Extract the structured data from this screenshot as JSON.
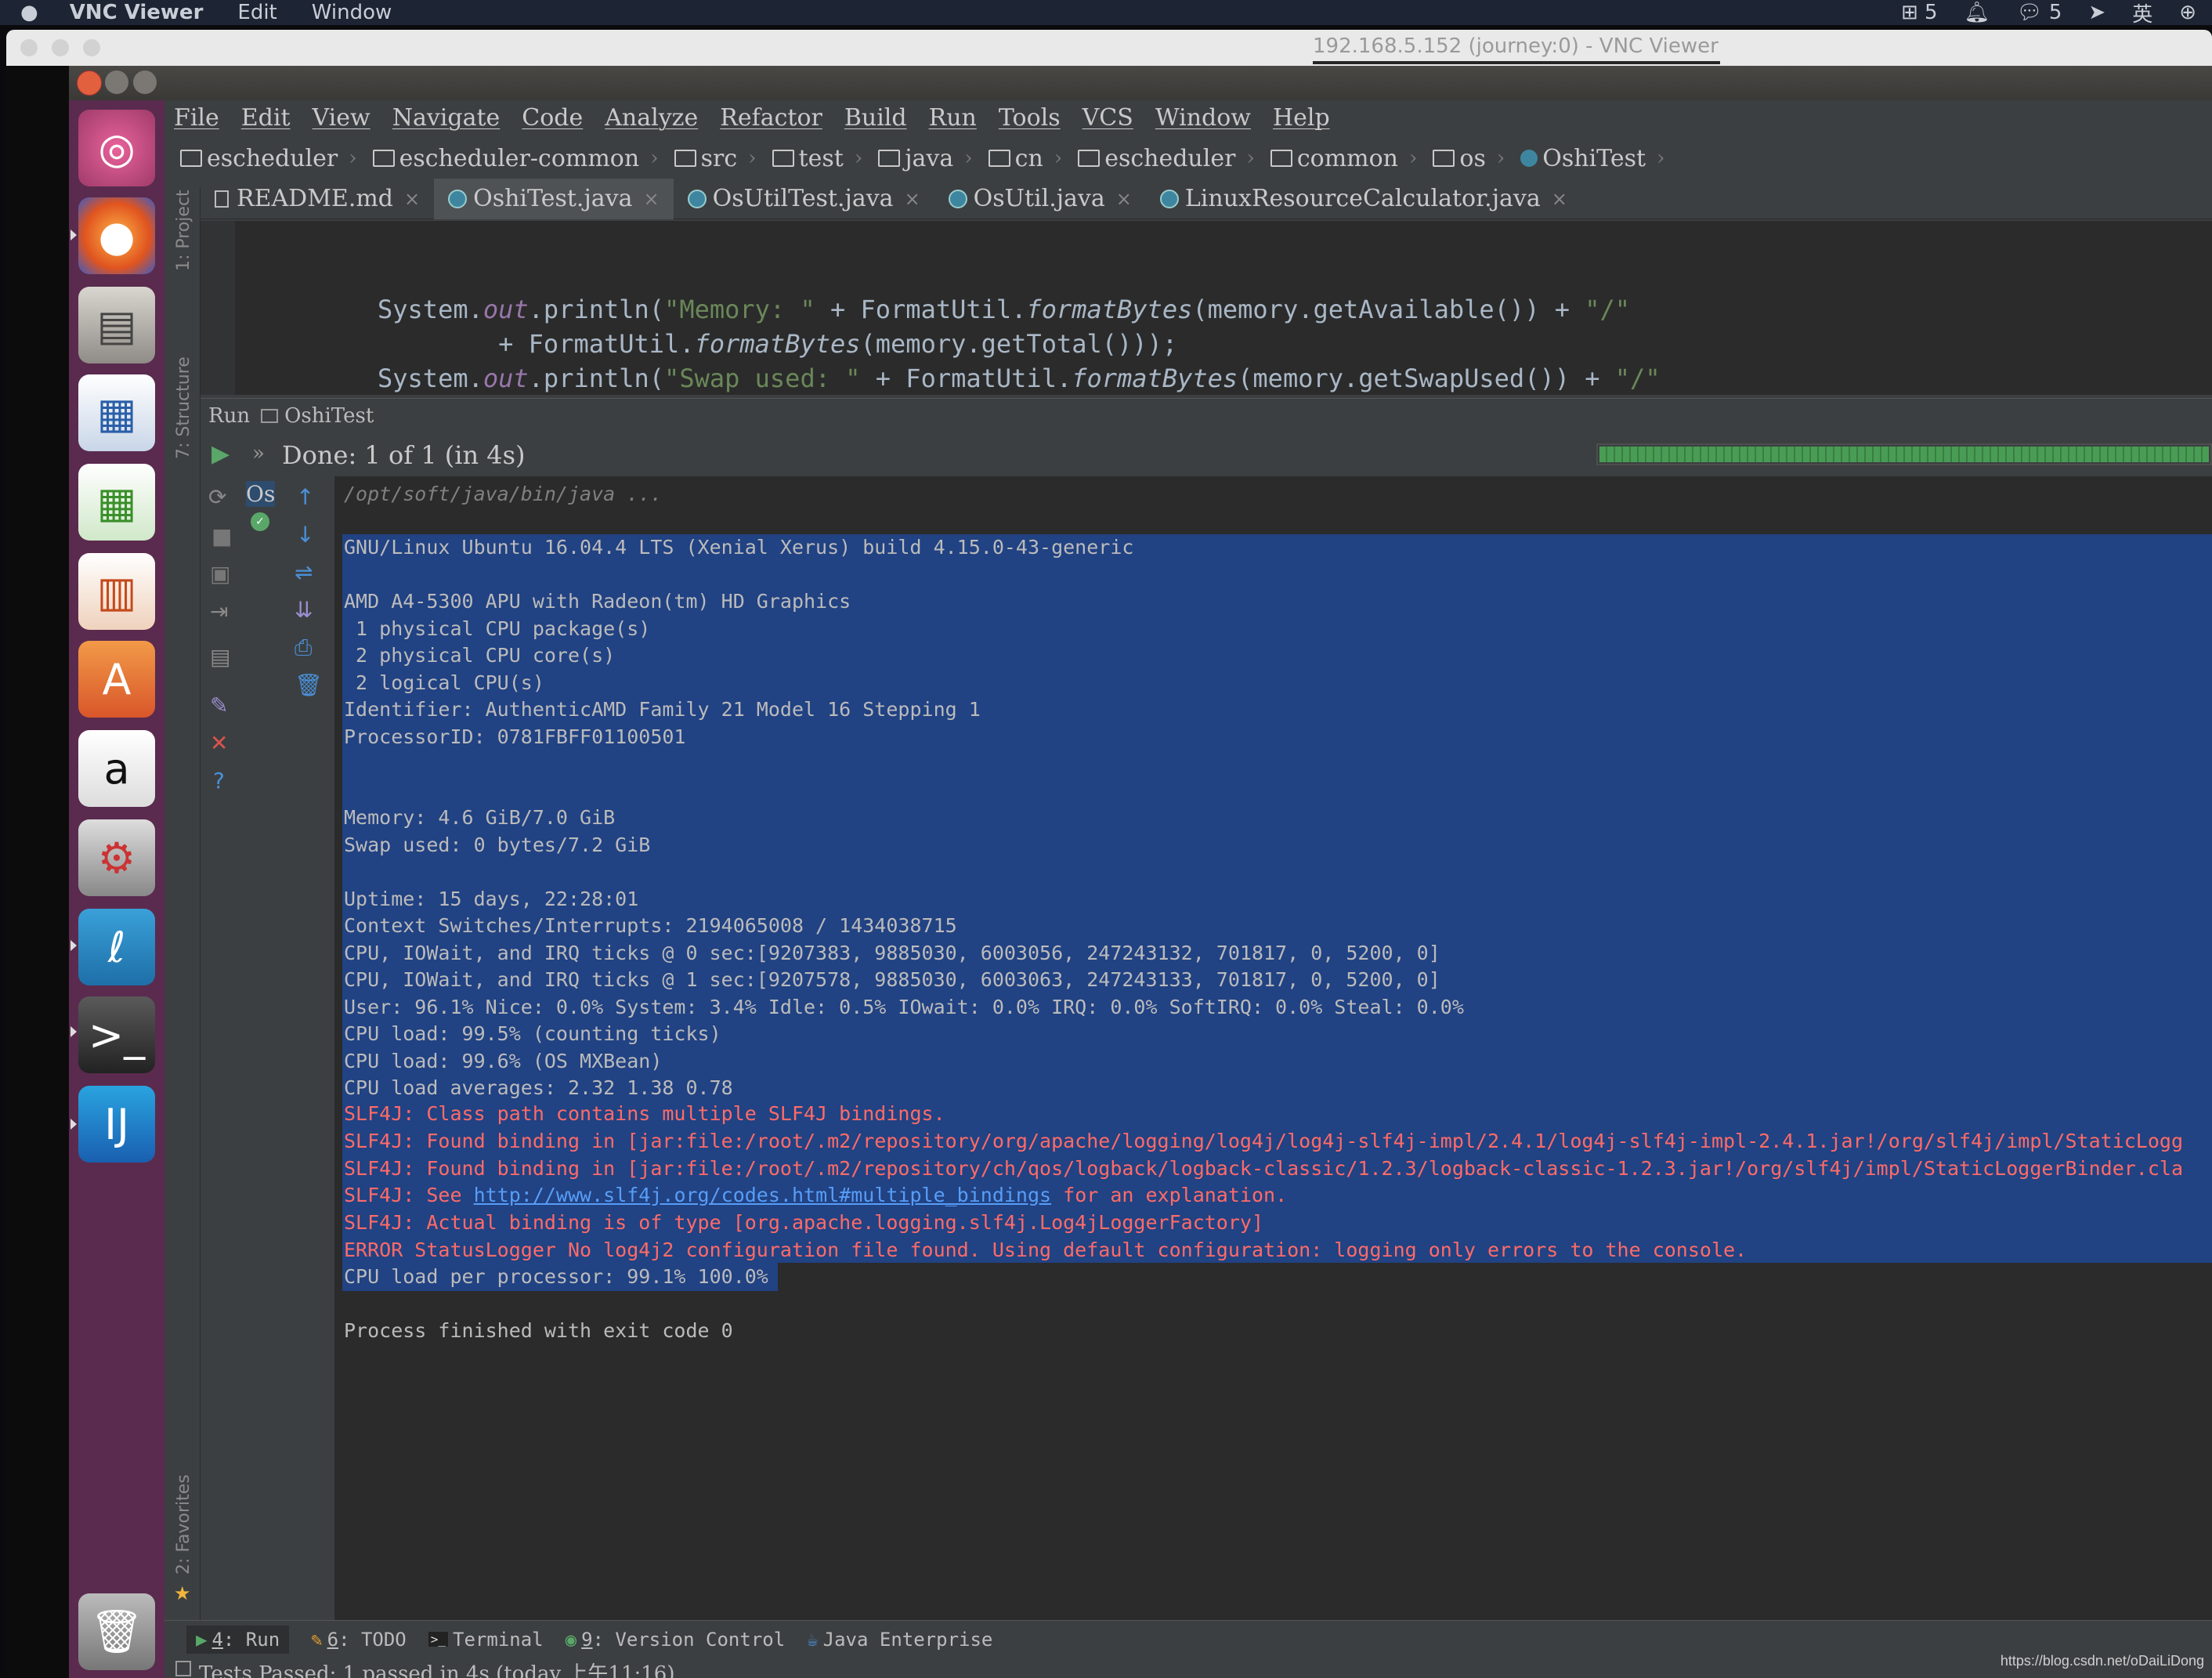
{
  "mac_menubar": {
    "app": "VNC Viewer",
    "items": [
      "Edit",
      "Window"
    ],
    "status": {
      "input_badge": "5",
      "chat_count": "5",
      "lang": "英"
    }
  },
  "vnc": {
    "title": "192.168.5.152 (journey:0) - VNC Viewer"
  },
  "ide": {
    "menu": [
      "File",
      "Edit",
      "View",
      "Navigate",
      "Code",
      "Analyze",
      "Refactor",
      "Build",
      "Run",
      "Tools",
      "VCS",
      "Window",
      "Help"
    ],
    "breadcrumbs": [
      "escheduler",
      "escheduler-common",
      "src",
      "test",
      "java",
      "cn",
      "escheduler",
      "common",
      "os",
      "OshiTest"
    ],
    "tabs": [
      "README.md",
      "OshiTest.java",
      "OsUtilTest.java",
      "OsUtil.java",
      "LinuxResourceCalculator.java"
    ],
    "side_labels": {
      "project": "1: Project",
      "structure": "7: Structure",
      "favorites": "2: Favorites"
    },
    "code": {
      "line1": {
        "a": "System.",
        "b": "out",
        "c": ".println(",
        "d": "\"Memory: \"",
        "e": " + FormatUtil.",
        "f": "formatBytes",
        "g": "(memory.getAvailable()) + ",
        "h": "\"/\""
      },
      "line2": {
        "a": "        + FormatUtil.",
        "b": "formatBytes",
        "c": "(memory.getTotal()));"
      },
      "line3": {
        "a": "System.",
        "b": "out",
        "c": ".println(",
        "d": "\"Swap used: \"",
        "e": " + FormatUtil.",
        "f": "formatBytes",
        "g": "(memory.getSwapUsed()) + ",
        "h": "\"/\""
      }
    },
    "run": {
      "label": "Run",
      "config": "OshiTest",
      "status": "Done: 1 of 1 (in 4s)",
      "progress": 1.0,
      "tree_item": "Os"
    },
    "console": {
      "command": "/opt/soft/java/bin/java ...",
      "lines": [
        "GNU/Linux Ubuntu 16.04.4 LTS (Xenial Xerus) build 4.15.0-43-generic",
        "",
        "AMD A4-5300 APU with Radeon(tm) HD Graphics",
        " 1 physical CPU package(s)",
        " 2 physical CPU core(s)",
        " 2 logical CPU(s)",
        "Identifier: AuthenticAMD Family 21 Model 16 Stepping 1",
        "ProcessorID: 0781FBFF01100501",
        "",
        "",
        "Memory: 4.6 GiB/7.0 GiB",
        "Swap used: 0 bytes/7.2 GiB",
        "",
        "Uptime: 15 days, 22:28:01",
        "Context Switches/Interrupts: 2194065008 / 1434038715",
        "CPU, IOWait, and IRQ ticks @ 0 sec:[9207383, 9885030, 6003056, 247243132, 701817, 0, 5200, 0]",
        "CPU, IOWait, and IRQ ticks @ 1 sec:[9207578, 9885030, 6003063, 247243133, 701817, 0, 5200, 0]",
        "User: 96.1% Nice: 0.0% System: 3.4% Idle: 0.5% IOwait: 0.0% IRQ: 0.0% SoftIRQ: 0.0% Steal: 0.0%",
        "CPU load: 99.5% (counting ticks)",
        "CPU load: 99.6% (OS MXBean)",
        "CPU load averages: 2.32 1.38 0.78"
      ],
      "errors": [
        "SLF4J: Class path contains multiple SLF4J bindings.",
        "SLF4J: Found binding in [jar:file:/root/.m2/repository/org/apache/logging/log4j/log4j-slf4j-impl/2.4.1/log4j-slf4j-impl-2.4.1.jar!/org/slf4j/impl/StaticLogg",
        "SLF4J: Found binding in [jar:file:/root/.m2/repository/ch/qos/logback/logback-classic/1.2.3/logback-classic-1.2.3.jar!/org/slf4j/impl/StaticLoggerBinder.cla"
      ],
      "see_line": {
        "prefix": "SLF4J: See ",
        "link": "http://www.slf4j.org/codes.html#multiple_bindings",
        "suffix": " for an explanation."
      },
      "errors2": [
        "SLF4J: Actual binding is of type [org.apache.logging.slf4j.Log4jLoggerFactory]",
        "ERROR StatusLogger No log4j2 configuration file found. Using default configuration: logging only errors to the console."
      ],
      "cpu_per_processor": "CPU load per processor: 99.1% 100.0%",
      "finished": "Process finished with exit code 0"
    },
    "bottom_tabs": {
      "run": {
        "key": "4",
        "label": ": Run"
      },
      "todo": {
        "key": "6",
        "label": ": TODO"
      },
      "terminal": "Terminal",
      "vcs": {
        "key": "9",
        "label": ": Version Control"
      },
      "javaee": "Java Enterprise"
    },
    "status_bar": "Tests Passed: 1 passed in 4s (today 上午11:16)"
  },
  "watermark": "https://blog.csdn.net/oDaiLiDong",
  "colors": {
    "selection": "#214283",
    "error": "#ff6b68",
    "launcher": "#5a2b4e"
  }
}
